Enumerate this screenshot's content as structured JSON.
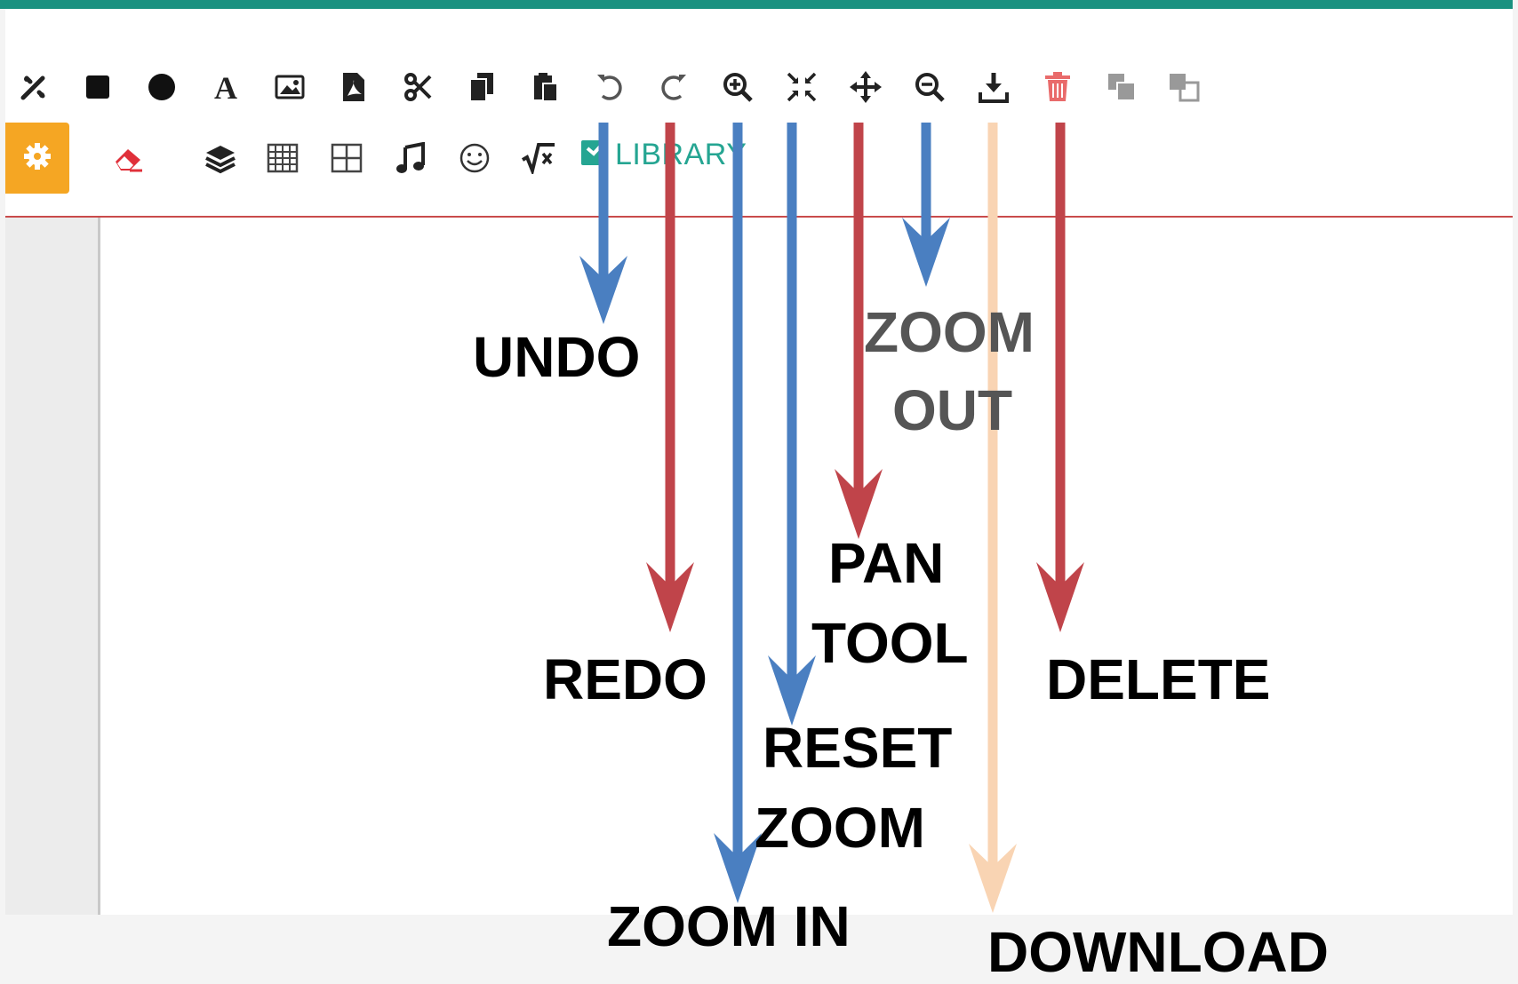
{
  "toolbar": {
    "row1": [
      {
        "name": "draw-tool-icon",
        "icon": "pen-ruler"
      },
      {
        "name": "rectangle-icon",
        "icon": "square"
      },
      {
        "name": "circle-icon",
        "icon": "circle"
      },
      {
        "name": "text-icon",
        "icon": "letter-a",
        "glyph": "A"
      },
      {
        "name": "image-icon",
        "icon": "image"
      },
      {
        "name": "pdf-icon",
        "icon": "pdf-file"
      },
      {
        "name": "cut-icon",
        "icon": "scissors"
      },
      {
        "name": "copy-icon",
        "icon": "copy"
      },
      {
        "name": "paste-icon",
        "icon": "paste"
      },
      {
        "name": "undo-icon",
        "icon": "undo"
      },
      {
        "name": "redo-icon",
        "icon": "redo"
      },
      {
        "name": "zoom-in-icon",
        "icon": "magnifier-plus"
      },
      {
        "name": "reset-zoom-icon",
        "icon": "compress"
      },
      {
        "name": "pan-icon",
        "icon": "arrows-move"
      },
      {
        "name": "zoom-out-icon",
        "icon": "magnifier-minus"
      },
      {
        "name": "download-icon",
        "icon": "download"
      },
      {
        "name": "delete-icon",
        "icon": "trash"
      },
      {
        "name": "bring-forward-icon",
        "icon": "layers-front"
      },
      {
        "name": "send-backward-icon",
        "icon": "layers-back"
      }
    ],
    "row2": [
      {
        "name": "settings-icon",
        "icon": "gear"
      },
      {
        "name": "eraser-icon",
        "icon": "eraser"
      },
      {
        "name": "layers-icon",
        "icon": "layers"
      },
      {
        "name": "grid-icon",
        "icon": "grid"
      },
      {
        "name": "table-icon",
        "icon": "table"
      },
      {
        "name": "music-icon",
        "icon": "music-note"
      },
      {
        "name": "emoji-icon",
        "icon": "smiley"
      },
      {
        "name": "math-icon",
        "icon": "square-root"
      }
    ],
    "library_label": "LIBRARY"
  },
  "annotations": {
    "undo": "UNDO",
    "redo": "REDO",
    "zoom_in": "ZOOM IN",
    "reset_zoom_line1": "RESET",
    "reset_zoom_line2": "ZOOM",
    "pan_tool_line1": "PAN",
    "pan_tool_line2": "TOOL",
    "zoom_out_line1": "ZOOM",
    "zoom_out_line2": "OUT",
    "download": "DOWNLOAD",
    "delete": "DELETE"
  },
  "colors": {
    "top_bar": "#1a9180",
    "settings_button": "#f5a623",
    "library": "#25a592",
    "arrow_blue": "#4a7fc1",
    "arrow_red": "#c0444a",
    "arrow_peach": "#f9d4b3",
    "delete_icon": "#e96b6b"
  }
}
